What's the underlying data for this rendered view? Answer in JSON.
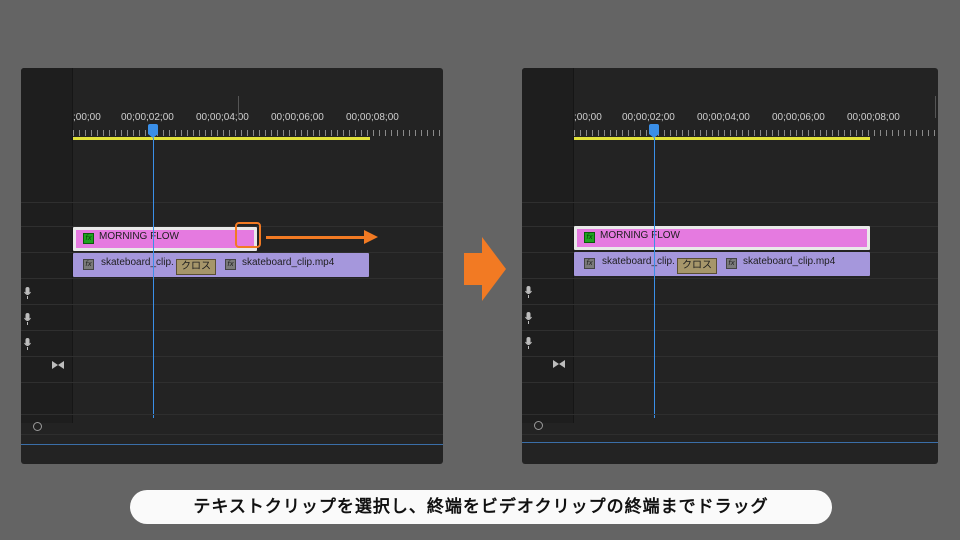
{
  "before_panel": {
    "timecodes": [
      ";00;00",
      "00;00;02;00",
      "00;00;04;00",
      "00;00;06;00",
      "00;00;08;00"
    ],
    "text_clip_label": "MORNING FLOW",
    "video_clip_a": "skateboard_clip.",
    "video_clip_b": "skateboard_clip.mp4",
    "transition_label": "クロス"
  },
  "after_panel": {
    "timecodes": [
      ";00;00",
      "00;00;02;00",
      "00;00;04;00",
      "00;00;06;00",
      "00;00;08;00"
    ],
    "text_clip_label": "MORNING FLOW",
    "video_clip_a": "skateboard_clip.",
    "video_clip_b": "skateboard_clip.mp4",
    "transition_label": "クロス"
  },
  "caption": "テキストクリップを選択し、終端をビデオクリップの終端までドラッグ",
  "colors": {
    "text_clip": "#e57ae0",
    "video_clip": "#a597dc",
    "playhead": "#3a8fe8",
    "work_area": "#e2e23a",
    "highlight": "#f27a23"
  },
  "icons": {
    "fx": "fx-badge-icon",
    "mic": "microphone-icon",
    "master": "bowtie-icon",
    "next_step": "right-arrow-icon",
    "drag": "drag-arrow-icon"
  }
}
